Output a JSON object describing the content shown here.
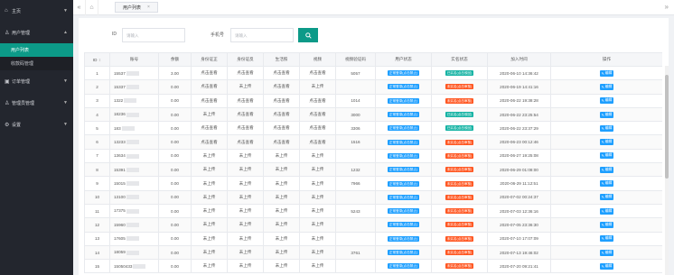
{
  "sidebar": {
    "items": [
      {
        "label": "主页",
        "icon": "home-icon",
        "caret": "▼"
      },
      {
        "label": "用户管理",
        "icon": "user-icon",
        "caret": "▲"
      },
      {
        "label": "订单管理",
        "icon": "order-icon",
        "caret": "▼"
      },
      {
        "label": "管理员管理",
        "icon": "admin-icon",
        "caret": "▼"
      },
      {
        "label": "设置",
        "icon": "gear-icon",
        "caret": "▼"
      }
    ],
    "subitems": [
      {
        "label": "用户列表",
        "active": true
      },
      {
        "label": "收款码管理",
        "active": false
      }
    ]
  },
  "topbar": {
    "collapse_icon": "«",
    "home_icon": "⌂",
    "tab_label": "用户列表",
    "tab_close": "×",
    "right_icon": "»"
  },
  "search": {
    "id_label": "ID",
    "id_placeholder": "请输入",
    "phone_label": "手机号",
    "phone_placeholder": "请输入"
  },
  "table": {
    "headers": [
      "ID",
      "账号",
      "余额",
      "身份证正",
      "身份证反",
      "生活照",
      "视频",
      "视频验证码",
      "用户状态",
      "实名状态",
      "加入时间",
      "操作"
    ],
    "edit_label": "编辑",
    "rows": [
      {
        "id": "1",
        "account": "15537",
        "balance": "3.00",
        "id_front": "点击查看",
        "id_back": "点击查看",
        "photo": "点击查看",
        "video": "点击查看",
        "code": "5057",
        "status": "正常登录(点击禁止)",
        "status_color": "blue",
        "real": "已实名(点击驳回)",
        "real_color": "green",
        "time": "2020-06-10 14:36:42"
      },
      {
        "id": "2",
        "account": "15337",
        "balance": "0.00",
        "id_front": "点击查看",
        "id_back": "未上传",
        "photo": "点击查看",
        "video": "未上传",
        "code": "",
        "status": "正常登录(点击禁止)",
        "status_color": "blue",
        "real": "未实名(点击审核)",
        "real_color": "red",
        "time": "2020-06-19 14:41:16"
      },
      {
        "id": "3",
        "account": "1322",
        "balance": "0.00",
        "id_front": "点击查看",
        "id_back": "点击查看",
        "photo": "点击查看",
        "video": "点击查看",
        "code": "1014",
        "status": "正常登录(点击禁止)",
        "status_color": "blue",
        "real": "未实名(点击审核)",
        "real_color": "red",
        "time": "2020-06-22 19:38:28"
      },
      {
        "id": "4",
        "account": "18236",
        "balance": "0.00",
        "id_front": "未上传",
        "id_back": "点击查看",
        "photo": "点击查看",
        "video": "点击查看",
        "code": "3000",
        "status": "正常登录(点击禁止)",
        "status_color": "blue",
        "real": "已实名(点击驳回)",
        "real_color": "green",
        "time": "2020-06-22 23:25:54"
      },
      {
        "id": "5",
        "account": "183",
        "balance": "0.00",
        "id_front": "点击查看",
        "id_back": "点击查看",
        "photo": "点击查看",
        "video": "点击查看",
        "code": "3306",
        "status": "正常登录(点击禁止)",
        "status_color": "blue",
        "real": "已实名(点击驳回)",
        "real_color": "green",
        "time": "2020-06-22 23:37:29"
      },
      {
        "id": "6",
        "account": "13233",
        "balance": "0.00",
        "id_front": "点击查看",
        "id_back": "点击查看",
        "photo": "点击查看",
        "video": "点击查看",
        "code": "1516",
        "status": "正常登录(点击禁止)",
        "status_color": "blue",
        "real": "未实名(点击审核)",
        "real_color": "red",
        "time": "2020-06-23 00:12:46"
      },
      {
        "id": "7",
        "account": "13634",
        "balance": "0.00",
        "id_front": "未上传",
        "id_back": "未上传",
        "photo": "未上传",
        "video": "未上传",
        "code": "",
        "status": "正常登录(点击禁止)",
        "status_color": "blue",
        "real": "未实名(点击审核)",
        "real_color": "red",
        "time": "2020-06-27 19:25:08"
      },
      {
        "id": "8",
        "account": "15391",
        "balance": "0.00",
        "id_front": "未上传",
        "id_back": "未上传",
        "photo": "未上传",
        "video": "未上传",
        "code": "1232",
        "status": "正常登录(点击禁止)",
        "status_color": "blue",
        "real": "未实名(点击审核)",
        "real_color": "red",
        "time": "2020-06-29 01:08:00"
      },
      {
        "id": "9",
        "account": "15015",
        "balance": "0.00",
        "id_front": "未上传",
        "id_back": "未上传",
        "photo": "未上传",
        "video": "未上传",
        "code": "7966",
        "status": "正常登录(点击禁止)",
        "status_color": "blue",
        "real": "未实名(点击审核)",
        "real_color": "red",
        "time": "2020-06-29 11:12:51"
      },
      {
        "id": "10",
        "account": "13100",
        "balance": "0.00",
        "id_front": "未上传",
        "id_back": "未上传",
        "photo": "未上传",
        "video": "未上传",
        "code": "",
        "status": "正常登录(点击禁止)",
        "status_color": "blue",
        "real": "未实名(点击审核)",
        "real_color": "red",
        "time": "2020-07-02 00:24:37"
      },
      {
        "id": "11",
        "account": "17375",
        "balance": "0.00",
        "id_front": "未上传",
        "id_back": "未上传",
        "photo": "未上传",
        "video": "未上传",
        "code": "5243",
        "status": "正常登录(点击禁止)",
        "status_color": "blue",
        "real": "未实名(点击审核)",
        "real_color": "red",
        "time": "2020-07-03 12:36:16"
      },
      {
        "id": "12",
        "account": "15960",
        "balance": "0.00",
        "id_front": "未上传",
        "id_back": "未上传",
        "photo": "未上传",
        "video": "未上传",
        "code": "",
        "status": "正常登录(点击禁止)",
        "status_color": "blue",
        "real": "未实名(点击审核)",
        "real_color": "red",
        "time": "2020-07-05 23:36:30"
      },
      {
        "id": "13",
        "account": "17605",
        "balance": "0.00",
        "id_front": "未上传",
        "id_back": "未上传",
        "photo": "未上传",
        "video": "未上传",
        "code": "",
        "status": "正常登录(点击禁止)",
        "status_color": "blue",
        "real": "未实名(点击审核)",
        "real_color": "red",
        "time": "2020-07-10 17:07:09"
      },
      {
        "id": "14",
        "account": "18059",
        "balance": "0.00",
        "id_front": "未上传",
        "id_back": "未上传",
        "photo": "未上传",
        "video": "未上传",
        "code": "3761",
        "status": "正常登录(点击禁止)",
        "status_color": "blue",
        "real": "未实名(点击审核)",
        "real_color": "red",
        "time": "2020-07-13 19:46:02"
      },
      {
        "id": "15",
        "account": "15050433",
        "balance": "0.00",
        "id_front": "未上传",
        "id_back": "未上传",
        "photo": "未上传",
        "video": "未上传",
        "code": "",
        "status": "正常登录(点击禁止)",
        "status_color": "blue",
        "real": "未实名(点击审核)",
        "real_color": "red",
        "time": "2020-07-20 09:21:41"
      }
    ]
  }
}
